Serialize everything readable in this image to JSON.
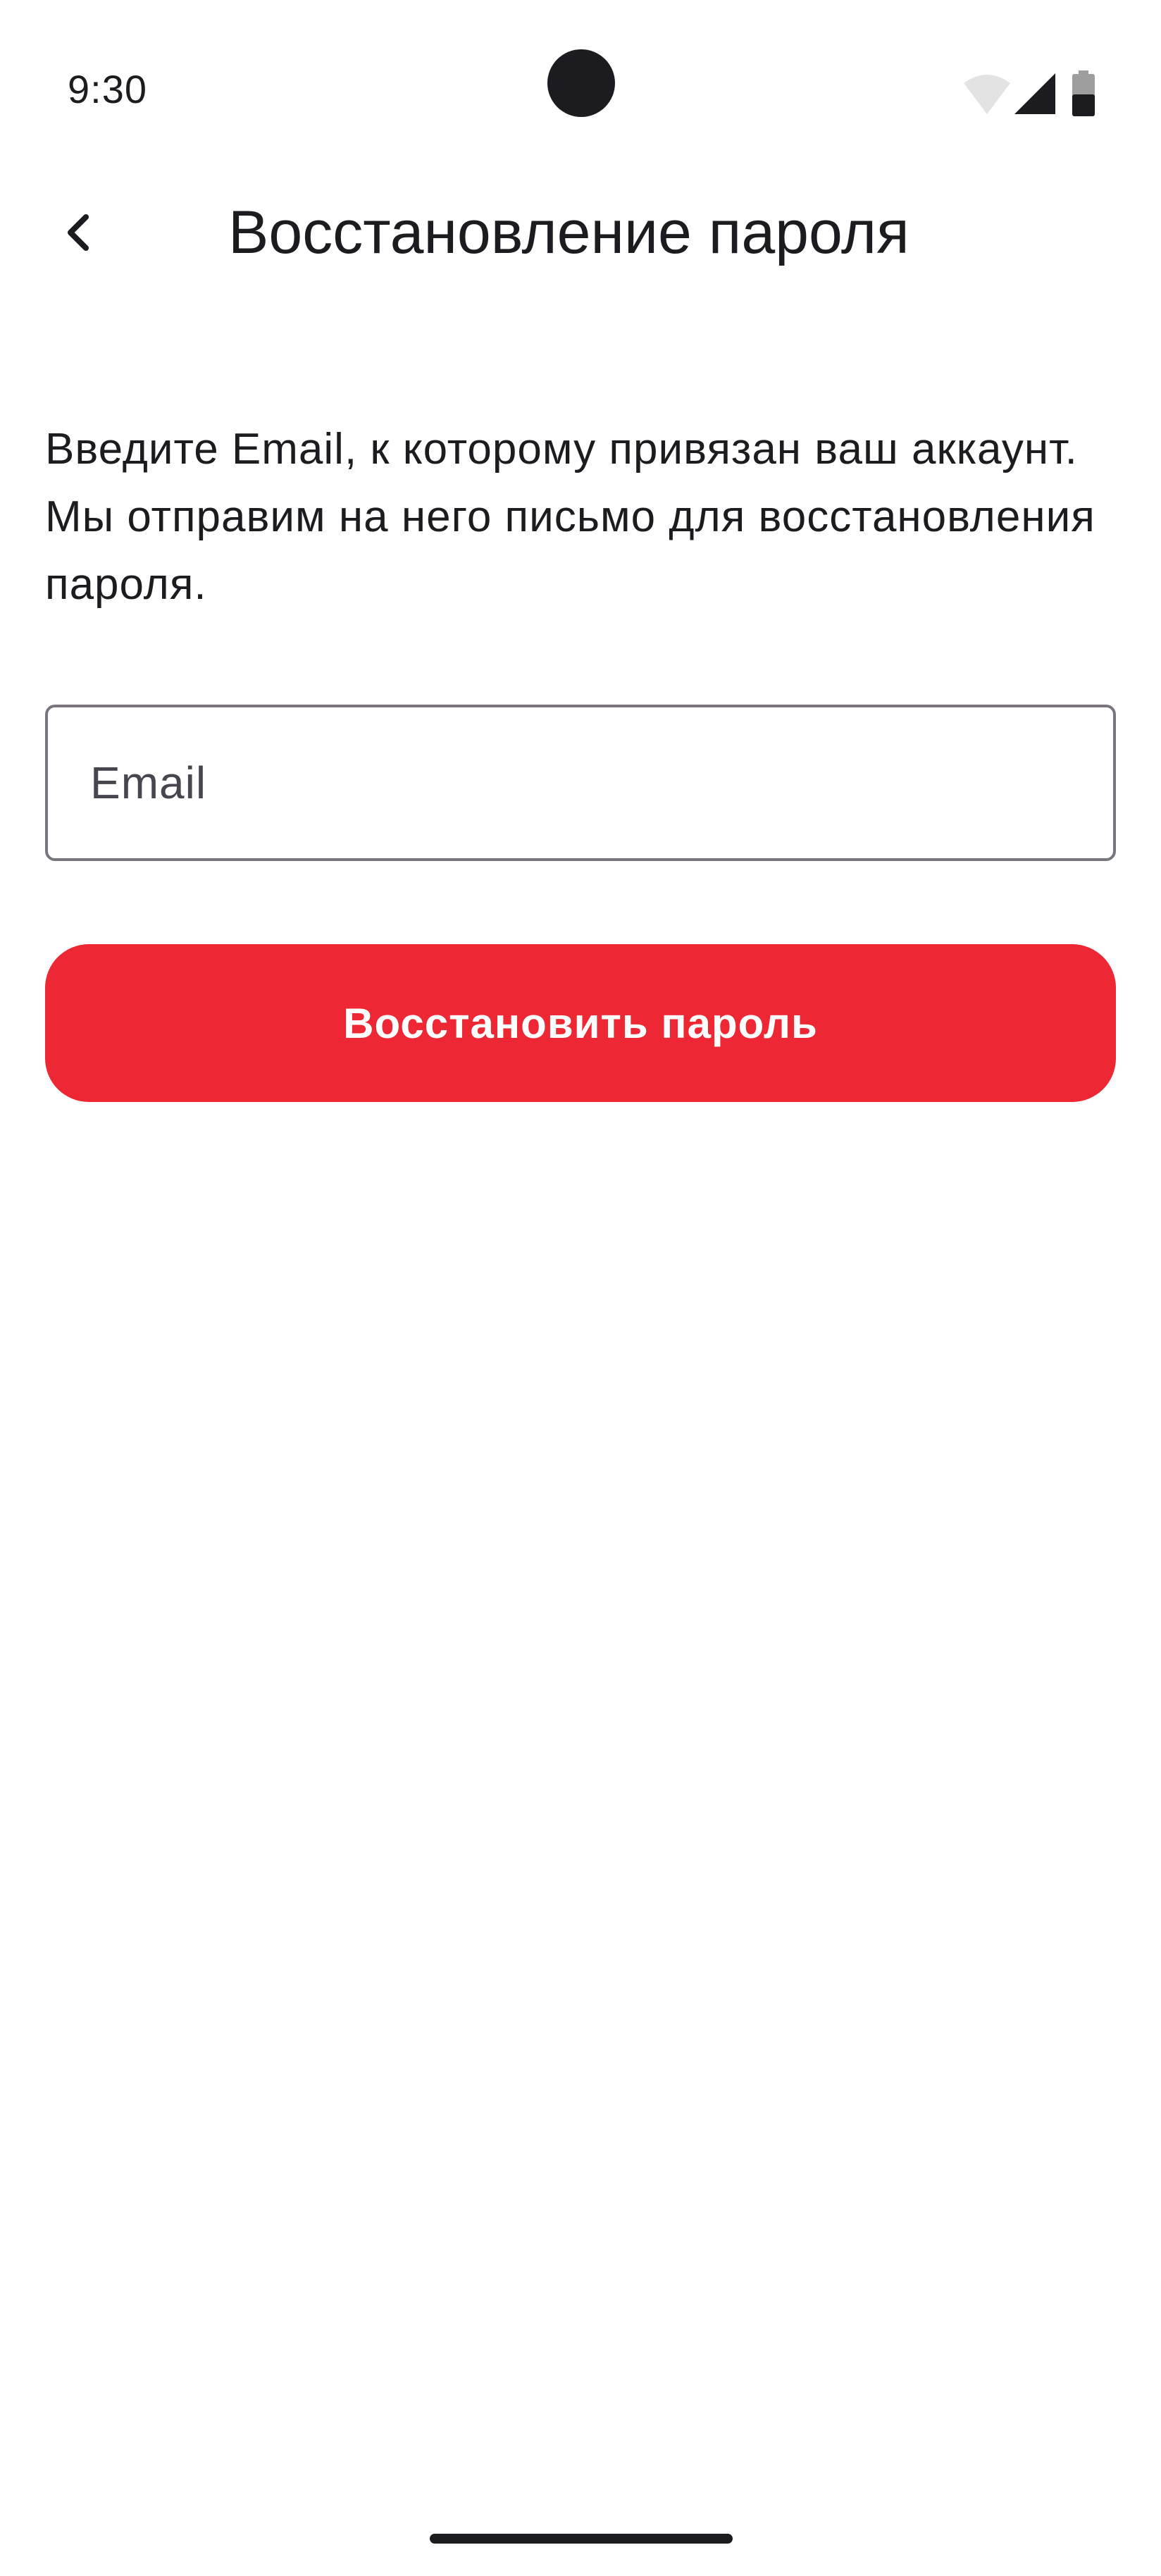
{
  "status_bar": {
    "time": "9:30",
    "icons": [
      "wifi-icon",
      "signal-icon",
      "battery-icon"
    ]
  },
  "app_bar": {
    "back_icon": "chevron-left-icon",
    "title": "Восстановление пароля"
  },
  "form": {
    "description": "Введите Email, к которому привязан ваш аккаунт. Мы отправим на него письмо для восстановления пароля.",
    "email_placeholder": "Email",
    "email_value": "",
    "submit_label": "Восстановить пароль"
  },
  "colors": {
    "accent": "#ed2733",
    "text": "#1c1b1f",
    "field_border": "#79747e",
    "placeholder": "#49454f",
    "background": "#ffffff"
  }
}
